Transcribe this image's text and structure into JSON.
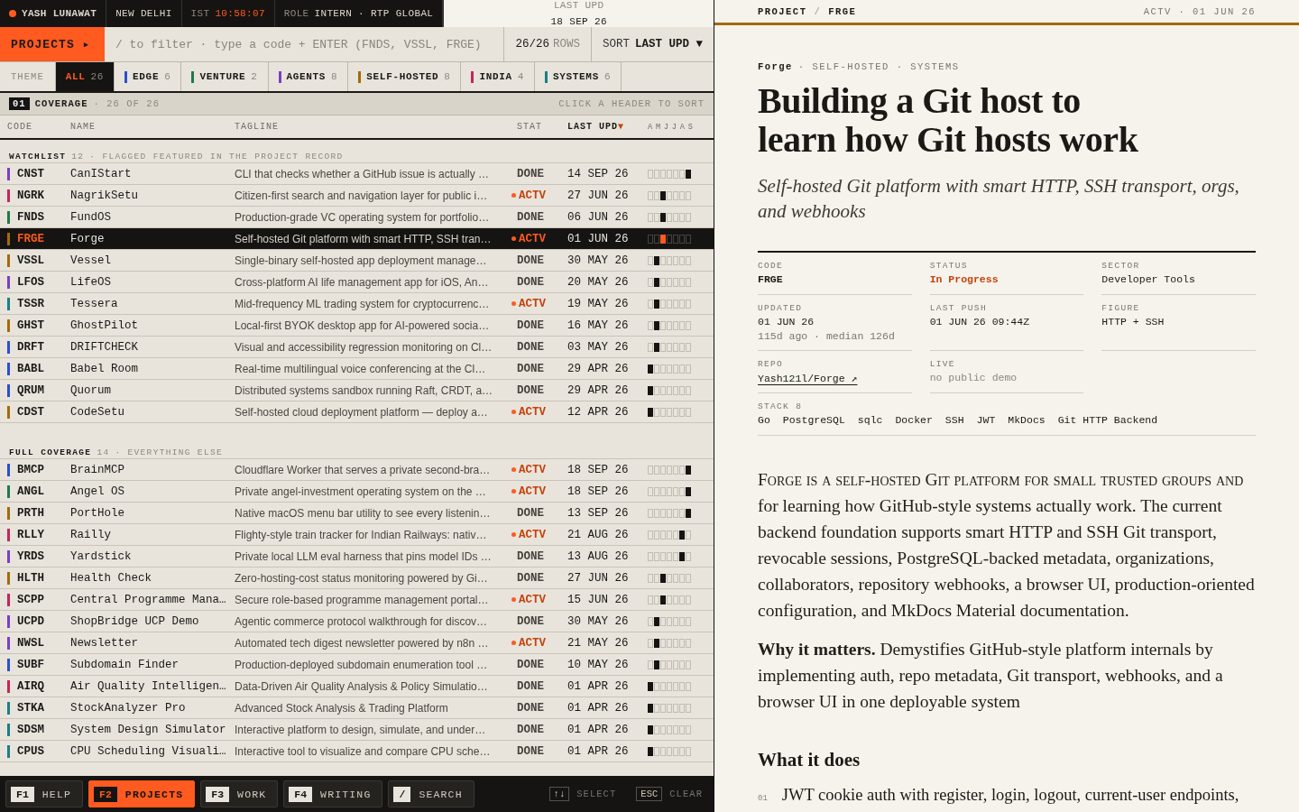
{
  "top_bar": {
    "user": "YASH LUNAWAT",
    "city": "NEW DELHI",
    "clock_label": "IST",
    "clock": "10:58:07",
    "role_label": "ROLE",
    "role": "INTERN · RTP GLOBAL",
    "updated_label": "LAST UPD",
    "updated": "18 SEP 26"
  },
  "command_bar": {
    "section": "PROJECTS ▸",
    "placeholder": "/ to filter · type a code + ENTER (FNDS, VSSL, FRGE)",
    "count": "26/26",
    "count_label": "ROWS",
    "sort_label": "SORT",
    "sort": "LAST UPD ▼"
  },
  "theme_label": "THEME",
  "tabs": [
    {
      "label": "ALL",
      "count": "26",
      "selected": true
    },
    {
      "label": "EDGE",
      "count": "6",
      "color": "#2a4fd0",
      "selected": false
    },
    {
      "label": "VENTURE",
      "count": "2",
      "color": "#1f7a4a",
      "selected": false
    },
    {
      "label": "AGENTS",
      "count": "8",
      "color": "#7b3fc4",
      "selected": false
    },
    {
      "label": "SELF-HOSTED",
      "count": "8",
      "color": "#a36a0a",
      "selected": false
    },
    {
      "label": "INDIA",
      "count": "4",
      "color": "#c8245a",
      "selected": false
    },
    {
      "label": "SYSTEMS",
      "count": "6",
      "color": "#1a7f86",
      "selected": false
    }
  ],
  "coverage": {
    "index": "01",
    "title": "COVERAGE",
    "count": "· 26 OF 26",
    "hint": "CLICK A HEADER TO SORT"
  },
  "columns": [
    {
      "label": "CODE",
      "sorted": false
    },
    {
      "label": "NAME",
      "sorted": false
    },
    {
      "label": "TAGLINE",
      "sorted": false
    },
    {
      "label": "STAT",
      "sorted": false
    },
    {
      "label": "LAST UPD",
      "sorted": true,
      "arrow": "▼"
    },
    {
      "label": "AMJJAS",
      "sorted": false
    }
  ],
  "groups": [
    {
      "title": "WATCHLIST",
      "count": "12",
      "note": "· FLAGGED FEATURED IN THE PROJECT RECORD",
      "rows": [
        {
          "code": "CNST",
          "name": "CanIStart",
          "tagline": "CLI that checks whether a GitHub issue is actually …",
          "status": "DONE",
          "active": false,
          "date": "14 SEP 26",
          "color": "#7b3fc4",
          "selected": false,
          "spark": [
            false,
            false,
            false,
            false,
            false,
            false,
            true
          ]
        },
        {
          "code": "NGRK",
          "name": "NagrikSetu",
          "tagline": "Citizen-first search and navigation layer for public i…",
          "status": "ACTV",
          "active": true,
          "date": "27 JUN 26",
          "color": "#c8245a",
          "selected": false,
          "spark": [
            false,
            false,
            true,
            false,
            false,
            false,
            false
          ]
        },
        {
          "code": "FNDS",
          "name": "FundOS",
          "tagline": "Production-grade VC operating system for portfolio…",
          "status": "DONE",
          "active": false,
          "date": "06 JUN 26",
          "color": "#1f7a4a",
          "selected": false,
          "spark": [
            false,
            false,
            true,
            false,
            false,
            false,
            false
          ]
        },
        {
          "code": "FRGE",
          "name": "Forge",
          "tagline": "Self-hosted Git platform with smart HTTP, SSH tran…",
          "status": "ACTV",
          "active": true,
          "date": "01 JUN 26",
          "color": "#a36a0a",
          "selected": true,
          "spark": [
            false,
            false,
            true,
            false,
            false,
            false,
            false
          ]
        },
        {
          "code": "VSSL",
          "name": "Vessel",
          "tagline": "Single-binary self-hosted app deployment manage…",
          "status": "DONE",
          "active": false,
          "date": "30 MAY 26",
          "color": "#a36a0a",
          "selected": false,
          "spark": [
            false,
            true,
            false,
            false,
            false,
            false,
            false
          ]
        },
        {
          "code": "LFOS",
          "name": "LifeOS",
          "tagline": "Cross-platform AI life management app for iOS, An…",
          "status": "DONE",
          "active": false,
          "date": "20 MAY 26",
          "color": "#7b3fc4",
          "selected": false,
          "spark": [
            false,
            true,
            false,
            false,
            false,
            false,
            false
          ]
        },
        {
          "code": "TSSR",
          "name": "Tessera",
          "tagline": "Mid-frequency ML trading system for cryptocurrenc…",
          "status": "ACTV",
          "active": true,
          "date": "19 MAY 26",
          "color": "#1a7f86",
          "selected": false,
          "spark": [
            false,
            true,
            false,
            false,
            false,
            false,
            false
          ]
        },
        {
          "code": "GHST",
          "name": "GhostPilot",
          "tagline": "Local-first BYOK desktop app for AI-powered socia…",
          "status": "DONE",
          "active": false,
          "date": "16 MAY 26",
          "color": "#a36a0a",
          "selected": false,
          "spark": [
            false,
            true,
            false,
            false,
            false,
            false,
            false
          ]
        },
        {
          "code": "DRFT",
          "name": "DRIFTCHECK",
          "tagline": "Visual and accessibility regression monitoring on Cl…",
          "status": "DONE",
          "active": false,
          "date": "03 MAY 26",
          "color": "#2a4fd0",
          "selected": false,
          "spark": [
            false,
            true,
            false,
            false,
            false,
            false,
            false
          ]
        },
        {
          "code": "BABL",
          "name": "Babel Room",
          "tagline": "Real-time multilingual voice conferencing at the Cl…",
          "status": "DONE",
          "active": false,
          "date": "29 APR 26",
          "color": "#2a4fd0",
          "selected": false,
          "spark": [
            true,
            false,
            false,
            false,
            false,
            false,
            false
          ]
        },
        {
          "code": "QRUM",
          "name": "Quorum",
          "tagline": "Distributed systems sandbox running Raft, CRDT, a…",
          "status": "DONE",
          "active": false,
          "date": "29 APR 26",
          "color": "#2a4fd0",
          "selected": false,
          "spark": [
            true,
            false,
            false,
            false,
            false,
            false,
            false
          ]
        },
        {
          "code": "CDST",
          "name": "CodeSetu",
          "tagline": "Self-hosted cloud deployment platform — deploy a…",
          "status": "ACTV",
          "active": true,
          "date": "12 APR 26",
          "color": "#a36a0a",
          "selected": false,
          "spark": [
            true,
            false,
            false,
            false,
            false,
            false,
            false
          ]
        }
      ]
    },
    {
      "title": "FULL COVERAGE",
      "count": "14",
      "note": "· EVERYTHING ELSE",
      "rows": [
        {
          "code": "BMCP",
          "name": "BrainMCP",
          "tagline": "Cloudflare Worker that serves a private second-bra…",
          "status": "ACTV",
          "active": true,
          "date": "18 SEP 26",
          "color": "#2a4fd0",
          "selected": false,
          "spark": [
            false,
            false,
            false,
            false,
            false,
            false,
            true
          ]
        },
        {
          "code": "ANGL",
          "name": "Angel OS",
          "tagline": "Private angel-investment operating system on the …",
          "status": "ACTV",
          "active": true,
          "date": "18 SEP 26",
          "color": "#1f7a4a",
          "selected": false,
          "spark": [
            false,
            false,
            false,
            false,
            false,
            false,
            true
          ]
        },
        {
          "code": "PRTH",
          "name": "PortHole",
          "tagline": "Native macOS menu bar utility to see every listenin…",
          "status": "DONE",
          "active": false,
          "date": "13 SEP 26",
          "color": "#a36a0a",
          "selected": false,
          "spark": [
            false,
            false,
            false,
            false,
            false,
            false,
            true
          ]
        },
        {
          "code": "RLLY",
          "name": "Railly",
          "tagline": "Flighty-style train tracker for Indian Railways: nativ…",
          "status": "ACTV",
          "active": true,
          "date": "21 AUG 26",
          "color": "#c8245a",
          "selected": false,
          "spark": [
            false,
            false,
            false,
            false,
            false,
            true,
            false
          ]
        },
        {
          "code": "YRDS",
          "name": "Yardstick",
          "tagline": "Private local LLM eval harness that pins model IDs …",
          "status": "DONE",
          "active": false,
          "date": "13 AUG 26",
          "color": "#7b3fc4",
          "selected": false,
          "spark": [
            false,
            false,
            false,
            false,
            false,
            true,
            false
          ]
        },
        {
          "code": "HLTH",
          "name": "Health Check",
          "tagline": "Zero-hosting-cost status monitoring powered by Gi…",
          "status": "DONE",
          "active": false,
          "date": "27 JUN 26",
          "color": "#a36a0a",
          "selected": false,
          "spark": [
            false,
            false,
            true,
            false,
            false,
            false,
            false
          ]
        },
        {
          "code": "SCPP",
          "name": "Central Programme Mana…",
          "tagline": "Secure role-based programme management portal…",
          "status": "ACTV",
          "active": true,
          "date": "15 JUN 26",
          "color": "#c8245a",
          "selected": false,
          "spark": [
            false,
            false,
            true,
            false,
            false,
            false,
            false
          ]
        },
        {
          "code": "UCPD",
          "name": "ShopBridge UCP Demo",
          "tagline": "Agentic commerce protocol walkthrough for discov…",
          "status": "DONE",
          "active": false,
          "date": "30 MAY 26",
          "color": "#7b3fc4",
          "selected": false,
          "spark": [
            false,
            true,
            false,
            false,
            false,
            false,
            false
          ]
        },
        {
          "code": "NWSL",
          "name": "Newsletter",
          "tagline": "Automated tech digest newsletter powered by n8n …",
          "status": "ACTV",
          "active": true,
          "date": "21 MAY 26",
          "color": "#7b3fc4",
          "selected": false,
          "spark": [
            false,
            true,
            false,
            false,
            false,
            false,
            false
          ]
        },
        {
          "code": "SUBF",
          "name": "Subdomain Finder",
          "tagline": "Production-deployed subdomain enumeration tool …",
          "status": "DONE",
          "active": false,
          "date": "10 MAY 26",
          "color": "#2a4fd0",
          "selected": false,
          "spark": [
            false,
            true,
            false,
            false,
            false,
            false,
            false
          ]
        },
        {
          "code": "AIRQ",
          "name": "Air Quality Intelligen…",
          "tagline": "Data-Driven Air Quality Analysis & Policy Simulatio…",
          "status": "DONE",
          "active": false,
          "date": "01 APR 26",
          "color": "#c8245a",
          "selected": false,
          "spark": [
            true,
            false,
            false,
            false,
            false,
            false,
            false
          ]
        },
        {
          "code": "STKA",
          "name": "StockAnalyzer Pro",
          "tagline": "Advanced Stock Analysis & Trading Platform",
          "status": "DONE",
          "active": false,
          "date": "01 APR 26",
          "color": "#1a7f86",
          "selected": false,
          "spark": [
            true,
            false,
            false,
            false,
            false,
            false,
            false
          ]
        },
        {
          "code": "SDSM",
          "name": "System Design Simulator",
          "tagline": "Interactive platform to design, simulate, and under…",
          "status": "DONE",
          "active": false,
          "date": "01 APR 26",
          "color": "#1a7f86",
          "selected": false,
          "spark": [
            true,
            false,
            false,
            false,
            false,
            false,
            false
          ]
        },
        {
          "code": "CPUS",
          "name": "CPU Scheduling Visuali…",
          "tagline": "Interactive tool to visualize and compare CPU sche…",
          "status": "DONE",
          "active": false,
          "date": "01 APR 26",
          "color": "#1a7f86",
          "selected": false,
          "spark": [
            true,
            false,
            false,
            false,
            false,
            false,
            false
          ]
        }
      ]
    }
  ],
  "footer": {
    "keys": [
      {
        "key": "F1",
        "label": "HELP",
        "selected": false
      },
      {
        "key": "F2",
        "label": "PROJECTS",
        "selected": true
      },
      {
        "key": "F3",
        "label": "WORK",
        "selected": false
      },
      {
        "key": "F4",
        "label": "WRITING",
        "selected": false
      },
      {
        "key": "/",
        "label": "SEARCH",
        "selected": false
      }
    ],
    "hints": [
      {
        "key": "↑↓",
        "label": "SELECT"
      },
      {
        "key": "ESC",
        "label": "CLEAR"
      }
    ]
  },
  "detail": {
    "breadcrumb": [
      "PROJECT",
      "/",
      "FRGE"
    ],
    "status_line": "ACTV · 01 JUN 26",
    "kicker": {
      "name": "Forge",
      "tags": "· SELF-HOSTED · SYSTEMS"
    },
    "title": "Building a Git host to\nlearn how Git hosts work",
    "subtitle": "Self-hosted Git platform with smart HTTP, SSH transport, orgs, and webhooks",
    "meta": [
      {
        "label": "CODE",
        "value": "FRGE",
        "kind": "strong"
      },
      {
        "label": "STATUS",
        "value": "In Progress",
        "kind": "status"
      },
      {
        "label": "SECTOR",
        "value": "Developer Tools",
        "kind": "plain"
      },
      {
        "label": "UPDATED",
        "value": "01 JUN 26",
        "note": "115d ago · median 126d",
        "kind": "plain"
      },
      {
        "label": "LAST PUSH",
        "value": "01 JUN 26 09:44Z",
        "kind": "plain"
      },
      {
        "label": "FIGURE",
        "value": "HTTP + SSH",
        "kind": "plain"
      },
      {
        "label": "REPO",
        "value": "Yash121l/Forge ↗",
        "kind": "link"
      },
      {
        "label": "LIVE",
        "value": "no public demo",
        "kind": "muted"
      }
    ],
    "stack_label": "STACK 8",
    "stack": [
      "Go",
      "PostgreSQL",
      "sqlc",
      "Docker",
      "SSH",
      "JWT",
      "MkDocs",
      "Git HTTP Backend"
    ],
    "intro_lead": "Forge is a self-hosted Git platform for small trusted groups and",
    "intro": "for learning how GitHub-style systems actually work. The current backend foundation supports smart HTTP and SSH Git transport, revocable sessions, PostgreSQL-backed metadata, organizations, collaborators, repository webhooks, a browser UI, production-oriented configuration, and MkDocs Material documentation.",
    "why": "**Why it matters.** Demystifies GitHub-style platform internals by implementing auth, repo metadata, Git transport, webhooks, and a browser UI in one deployable system",
    "section": "What it does",
    "features": [
      {
        "index": "01",
        "text": "JWT cookie auth with register, login, logout, current-user endpoints,"
      }
    ]
  }
}
